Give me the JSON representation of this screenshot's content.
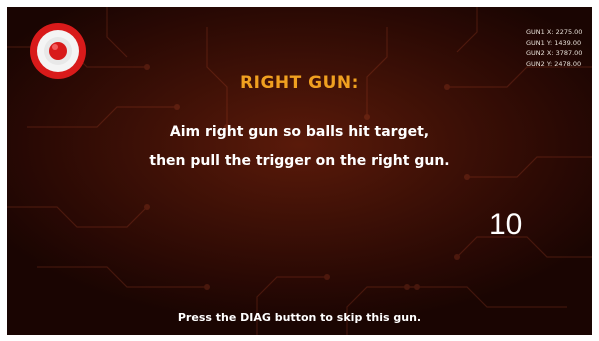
{
  "icon": "target-icon",
  "debug": {
    "gun1_x": "GUN1 X: 2275.00",
    "gun1_y": "GUN1 Y: 1439.00",
    "gun2_x": "GUN2 X: 3787.00",
    "gun2_y": "GUN2 Y: 2478.00"
  },
  "calibration": {
    "title": "RIGHT GUN:",
    "instruction_line1": "Aim right gun so balls hit target,",
    "instruction_line2": "then pull the trigger on the right gun.",
    "countdown": "10",
    "footer": "Press the DIAG button to skip this gun."
  },
  "colors": {
    "title": "#f0a020",
    "background": "#3d1006",
    "text": "#ffffff",
    "target_red": "#d81a1a"
  }
}
